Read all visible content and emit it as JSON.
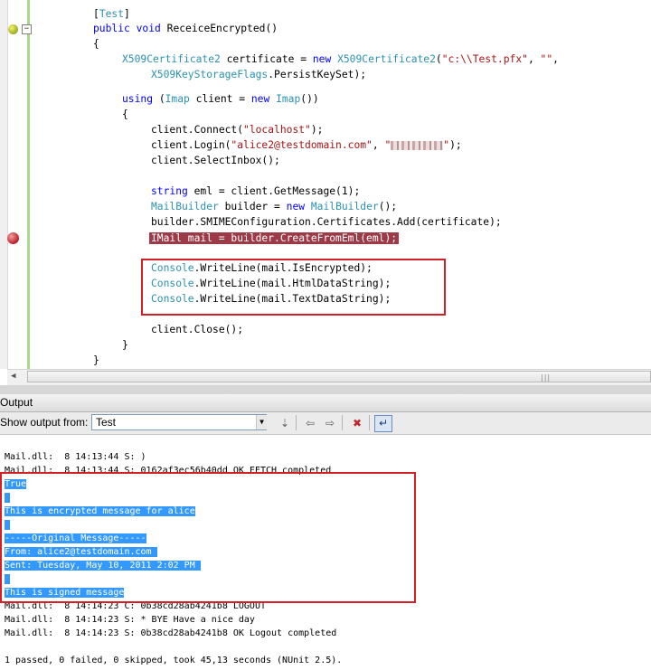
{
  "editor": {
    "attribute_line": {
      "open": "[",
      "attr": "Test",
      "close": "]"
    },
    "method_line": {
      "kw1": "public",
      "kw2": "void",
      "name": " ReceiceEncrypted()"
    },
    "open_brace": "{",
    "cert_line1": {
      "type": "X509Certificate2",
      "var": " certificate = ",
      "kw": "new",
      "type2": "X509Certificate2",
      "args_open": "(",
      "path": "\"c:\\\\Test.pfx\"",
      "sep": ", ",
      "empty": "\"\"",
      "tail": ","
    },
    "cert_line2": {
      "type": "X509KeyStorageFlags",
      "rest": ".PersistKeySet);"
    },
    "using_line": {
      "kw": "using",
      "open": " (",
      "type": "Imap",
      "mid": " client = ",
      "kw2": "new",
      "type2": "Imap",
      "close": "())"
    },
    "inner_brace": "{",
    "connect_line": {
      "pre": "client.Connect(",
      "arg": "\"localhost\"",
      "post": ");"
    },
    "login_line": {
      "pre": "client.Login(",
      "arg1": "\"alice2@testdomain.com\"",
      "sep": ", ",
      "q1": "\"",
      "q2": "\"",
      "post": ");"
    },
    "selectinbox_line": "client.SelectInbox();",
    "eml_line": {
      "kw": "string",
      "rest": " eml = client.GetMessage(1);"
    },
    "builder_line": {
      "type": "MailBuilder",
      "mid": " builder = ",
      "kw": "new",
      "type2": "MailBuilder",
      "post": "();"
    },
    "smime_line": "builder.SMIMEConfiguration.Certificates.Add(certificate);",
    "breakpoint_line": "IMail mail = builder.CreateFromEml(eml);",
    "writelines": [
      {
        "type": "Console",
        "rest": ".WriteLine(mail.IsEncrypted);"
      },
      {
        "type": "Console",
        "rest": ".WriteLine(mail.HtmlDataString);"
      },
      {
        "type": "Console",
        "rest": ".WriteLine(mail.TextDataString);"
      }
    ],
    "close_line": "client.Close();",
    "inner_close": "}",
    "outer_close": "}",
    "fold_symbol": "−"
  },
  "output_panel": {
    "title": "Output",
    "show_label_prefix": "Show output from:",
    "selected_source": "Test",
    "lines": [
      {
        "text": "Mail.dll:  8 14:13:44 S: )",
        "selected": false
      },
      {
        "text": "Mail.dll:  8 14:13:44 S: 0162af3ec56b40dd OK FETCH completed",
        "selected": false
      },
      {
        "text": "True",
        "selected": true
      },
      {
        "text": " ",
        "selected": true
      },
      {
        "text": "This is encrypted message for alice",
        "selected": true
      },
      {
        "text": " ",
        "selected": true
      },
      {
        "text": "-----Original Message-----",
        "selected": true
      },
      {
        "text": "From: alice2@testdomain.com ",
        "selected": true
      },
      {
        "text": "Sent: Tuesday, May 10, 2011 2:02 PM ",
        "selected": true
      },
      {
        "text": " ",
        "selected": true
      },
      {
        "text": "This is signed message",
        "selected": true
      },
      {
        "text": "Mail.dll:  8 14:14:23 C: 0b38cd28ab4241b8 LOGOUT",
        "selected": false
      },
      {
        "text": "Mail.dll:  8 14:14:23 S: * BYE Have a nice day",
        "selected": false
      },
      {
        "text": "Mail.dll:  8 14:14:23 S: 0b38cd28ab4241b8 OK Logout completed",
        "selected": false
      },
      {
        "text": "",
        "selected": false
      },
      {
        "text": "1 passed, 0 failed, 0 skipped, took 45,13 seconds (NUnit 2.5).",
        "selected": false
      }
    ]
  },
  "colors": {
    "keyword": "#0000ff",
    "type": "#2b91af",
    "string": "#a31515",
    "breakpoint_highlight": "#9c3a47",
    "selection": "#3399ff",
    "annotation_box": "#d31f26"
  }
}
